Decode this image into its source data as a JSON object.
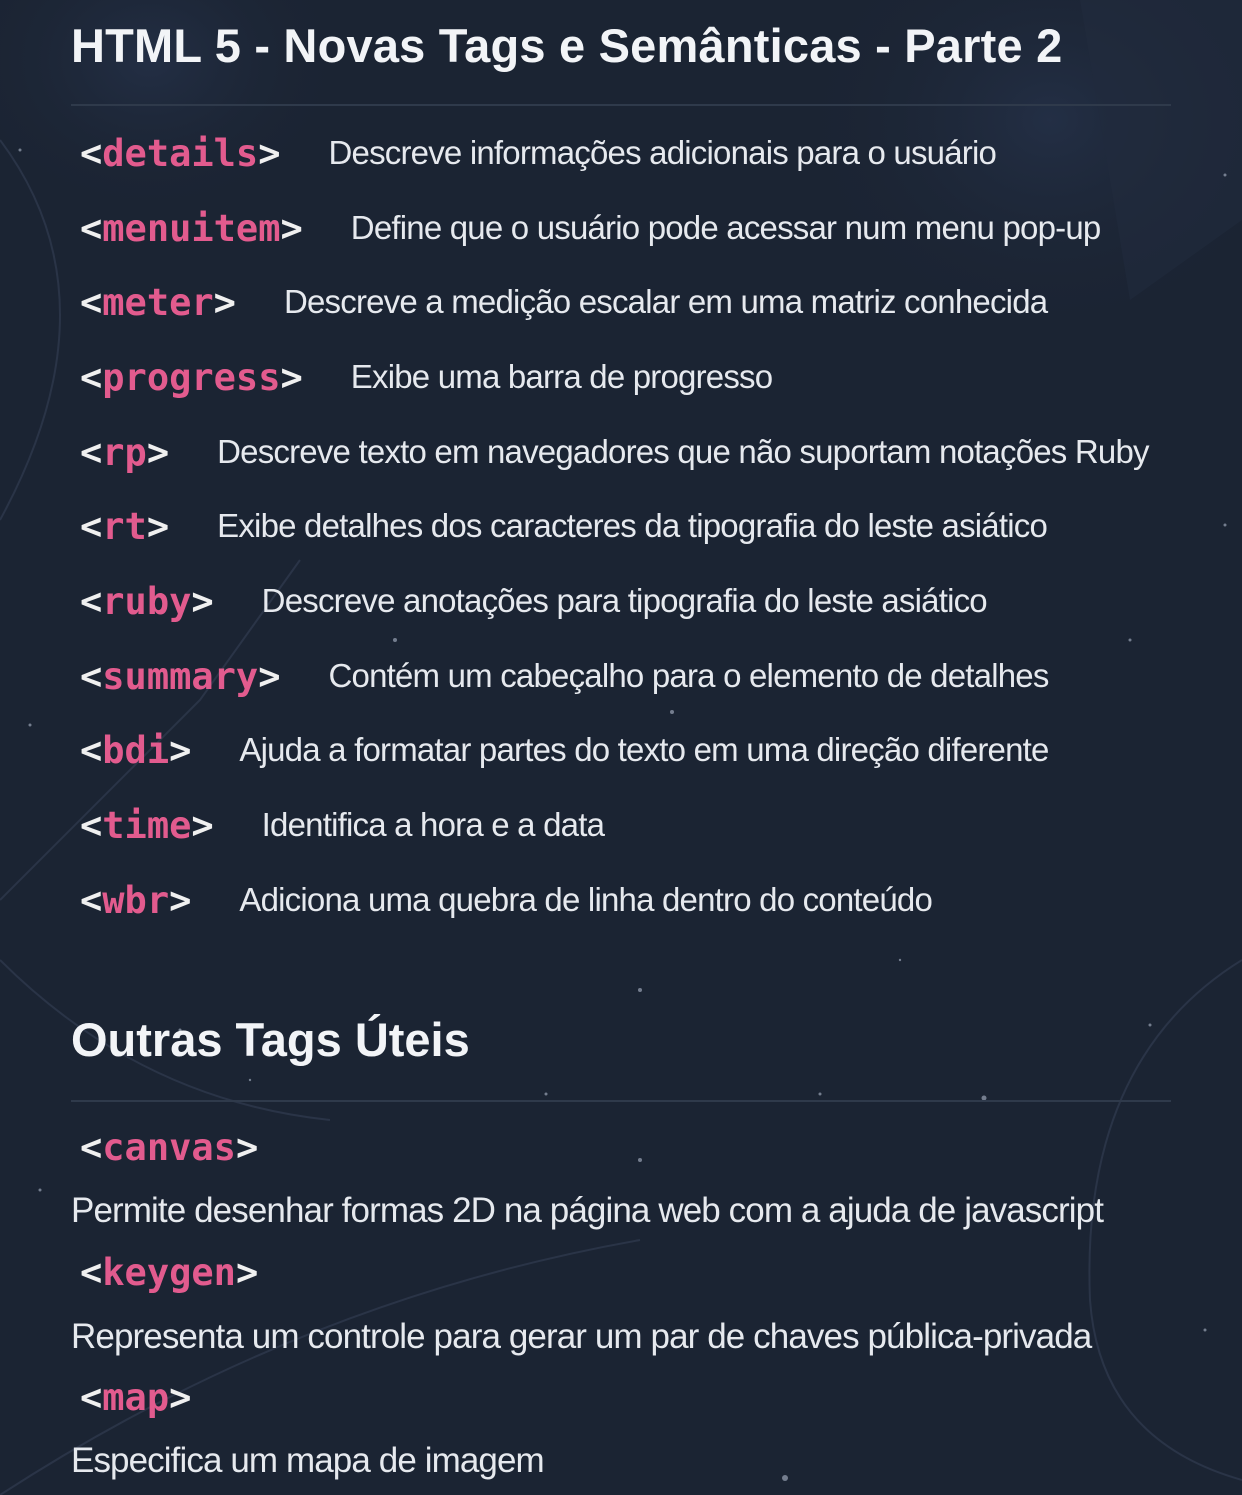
{
  "page": {
    "title": "HTML 5 - Novas Tags e Semânticas - Parte 2",
    "colors": {
      "background": "#1b2433",
      "tag_name": "#e25b8e",
      "text": "#e6e9ee",
      "divider": "#2f3a4b"
    }
  },
  "tags": [
    {
      "open": "<",
      "name": "details",
      "close": ">",
      "description": "Descreve informações adicionais para o usuário"
    },
    {
      "open": "<",
      "name": "menuitem",
      "close": ">",
      "description": "Define que o usuário pode acessar num menu pop-up"
    },
    {
      "open": "<",
      "name": "meter",
      "close": ">",
      "description": "Descreve a medição escalar em uma matriz conhecida"
    },
    {
      "open": "<",
      "name": "progress",
      "close": ">",
      "description": "Exibe uma barra de progresso"
    },
    {
      "open": "<",
      "name": "rp",
      "close": ">",
      "description": "Descreve texto em navegadores que não suportam notações Ruby"
    },
    {
      "open": "<",
      "name": "rt",
      "close": ">",
      "description": "Exibe detalhes dos caracteres da tipografia do leste asiático"
    },
    {
      "open": "<",
      "name": "ruby",
      "close": ">",
      "description": "Descreve anotações para tipografia do leste asiático"
    },
    {
      "open": "<",
      "name": "summary",
      "close": ">",
      "description": "Contém um cabeçalho para o elemento de detalhes"
    },
    {
      "open": "<",
      "name": "bdi",
      "close": ">",
      "description": "Ajuda a formatar partes do texto em uma direção diferente"
    },
    {
      "open": "<",
      "name": "time",
      "close": ">",
      "description": "Identifica a hora e a data"
    },
    {
      "open": "<",
      "name": "wbr",
      "close": ">",
      "description": "Adiciona uma quebra de linha dentro do conteúdo"
    }
  ],
  "other": {
    "title": "Outras Tags Úteis",
    "items": [
      {
        "open": "<",
        "name": "canvas",
        "close": ">",
        "description": "Permite desenhar formas 2D na página web com a ajuda de javascript"
      },
      {
        "open": "<",
        "name": "keygen",
        "close": ">",
        "description": "Representa um controle para gerar um par de chaves pública-privada"
      },
      {
        "open": "<",
        "name": "map",
        "close": ">",
        "description": "Especifica um mapa de imagem"
      }
    ]
  }
}
